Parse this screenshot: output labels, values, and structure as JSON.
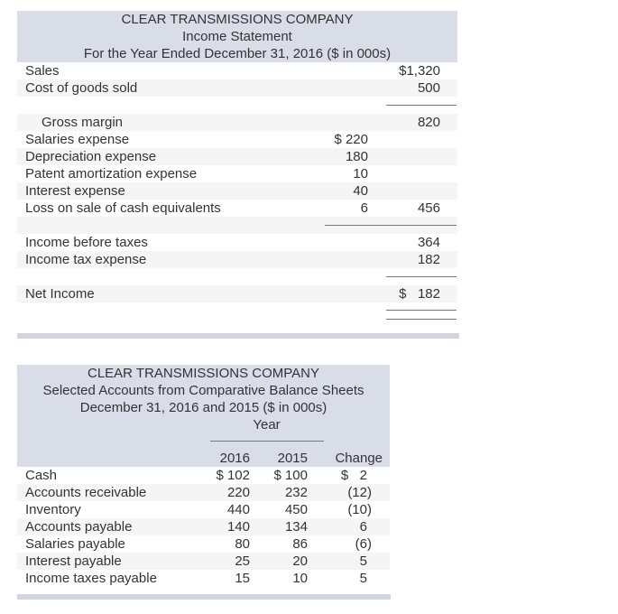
{
  "income_statement": {
    "title": "CLEAR TRANSMISSIONS COMPANY",
    "subtitle": "Income Statement",
    "period": "For the Year Ended December 31, 2016 ($ in 000s)",
    "rows": [
      {
        "label": "Sales",
        "col1": "",
        "col2": "$1,320"
      },
      {
        "label": "Cost of goods sold",
        "col1": "",
        "col2": "500"
      },
      {
        "label": "",
        "col1": "",
        "col2": ""
      },
      {
        "label": "Gross margin",
        "col1": "",
        "col2": "820"
      },
      {
        "label": "Salaries expense",
        "col1": "$ 220",
        "col2": ""
      },
      {
        "label": "Depreciation expense",
        "col1": "180",
        "col2": ""
      },
      {
        "label": "Patent amortization expense",
        "col1": "10",
        "col2": ""
      },
      {
        "label": "Interest expense",
        "col1": "40",
        "col2": ""
      },
      {
        "label": "Loss on sale of cash equivalents",
        "col1": "6",
        "col2": "456"
      },
      {
        "label": "",
        "col1": "",
        "col2": ""
      },
      {
        "label": "Income before taxes",
        "col1": "",
        "col2": "364"
      },
      {
        "label": "Income tax expense",
        "col1": "",
        "col2": "182"
      },
      {
        "label": "",
        "col1": "",
        "col2": ""
      },
      {
        "label": "Net Income",
        "col1": "",
        "col2": "$   182"
      }
    ]
  },
  "balance_sheet": {
    "title": "CLEAR TRANSMISSIONS COMPANY",
    "subtitle": "Selected Accounts from Comparative Balance Sheets",
    "period": "December 31, 2016 and 2015 ($ in 000s)",
    "group_header": "Year",
    "columns": [
      "2016",
      "2015",
      "Change"
    ],
    "rows": [
      {
        "label": "Cash",
        "y2016": "$ 102",
        "y2015": "$ 100",
        "change": "$   2"
      },
      {
        "label": "Accounts receivable",
        "y2016": "220",
        "y2015": "232",
        "change": "(12)"
      },
      {
        "label": "Inventory",
        "y2016": "440",
        "y2015": "450",
        "change": "(10)"
      },
      {
        "label": "Accounts payable",
        "y2016": "140",
        "y2015": "134",
        "change": "6"
      },
      {
        "label": "Salaries payable",
        "y2016": "80",
        "y2015": "86",
        "change": "(6)"
      },
      {
        "label": "Interest payable",
        "y2016": "25",
        "y2015": "20",
        "change": "5"
      },
      {
        "label": "Income taxes payable",
        "y2016": "15",
        "y2015": "10",
        "change": "5"
      }
    ]
  }
}
